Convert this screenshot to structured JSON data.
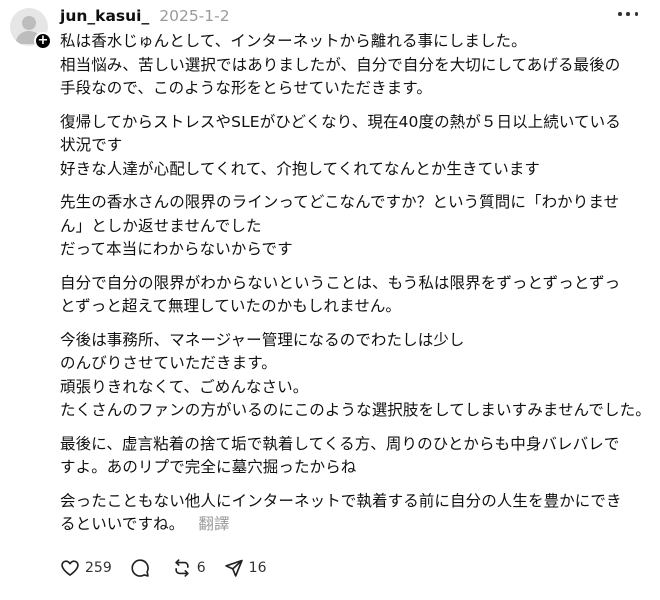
{
  "post": {
    "username": "jun_kasui_",
    "timestamp": "2025-1-2",
    "paragraphs": [
      [
        "私は香水じゅんとして、インターネットから離れる事にしました。",
        "相当悩み、苦しい選択ではありましたが、自分で自分を大切にしてあげる最後の",
        "手段なので、このような形をとらせていただきます。"
      ],
      [
        "復帰してからストレスやSLEがひどくなり、現在40度の熱が５日以上続いている",
        "状況です",
        "好きな人達が心配してくれて、介抱してくれてなんとか生きています"
      ],
      [
        "先生の香水さんの限界のラインってどこなんですか？という質問に「わかりませ",
        "ん」としか返せませんでした",
        "だって本当にわからないからです"
      ],
      [
        "自分で自分の限界がわからないということは、もう私は限界をずっとずっとずっ",
        "とずっと超えて無理していたのかもしれません。"
      ],
      [
        "今後は事務所、マネージャー管理になるのでわたしは少し",
        "のんびりさせていただきます。",
        "頑張りきれなくて、ごめんなさい。",
        "たくさんのファンの方がいるのにこのような選択肢をしてしまいすみませんでした。"
      ],
      [
        "最後に、虚言粘着の捨て垢で執着してくる方、周りのひとからも中身バレバレで",
        "すよ。あのリプで完全に墓穴掘ったからね"
      ],
      [
        "会ったこともない他人にインターネットで執着する前に自分の人生を豊かにでき",
        "るといいですね。"
      ]
    ],
    "translate_label": "翻譯",
    "likes": "259",
    "reposts": "6",
    "shares": "16"
  },
  "icons": {
    "avatar": "avatar-silhouette",
    "badge": "plus-icon",
    "more": "more-horizontal-icon",
    "like": "heart-icon",
    "comment": "comment-icon",
    "repost": "repost-icon",
    "share": "send-icon"
  }
}
